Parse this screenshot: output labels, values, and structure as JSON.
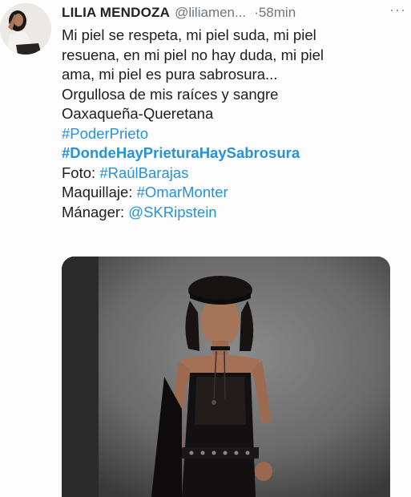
{
  "tweet": {
    "author_name": "LILIA MENDOZA",
    "handle": "@liliamen...",
    "time": "·58min",
    "more_label": "···",
    "lines": [
      "Mi piel se respeta, mi piel suda, mi piel",
      "resuena, en mi piel no hay duda, mi piel",
      "ama, mi piel es pura sabrosura...",
      "Orgullosa de mis raíces y sangre",
      "Oaxaqueña-Queretana"
    ],
    "hashtag_1": "#PoderPrieto",
    "hashtag_2": "#DondeHayPrieturaHaySabrosura",
    "photo_label": "Foto:",
    "photo_tag": "#RaúlBarajas",
    "makeup_label": "Maquillaje:",
    "makeup_tag": "#OmarMonter",
    "manager_label": "Mánager:",
    "manager_mention": "@SKRipstein"
  },
  "colors": {
    "link": "#2592d9",
    "text": "#1d1d1d",
    "muted": "#6e7880"
  },
  "icons": {
    "avatar": "profile-photo",
    "more": "more-dots-icon"
  }
}
